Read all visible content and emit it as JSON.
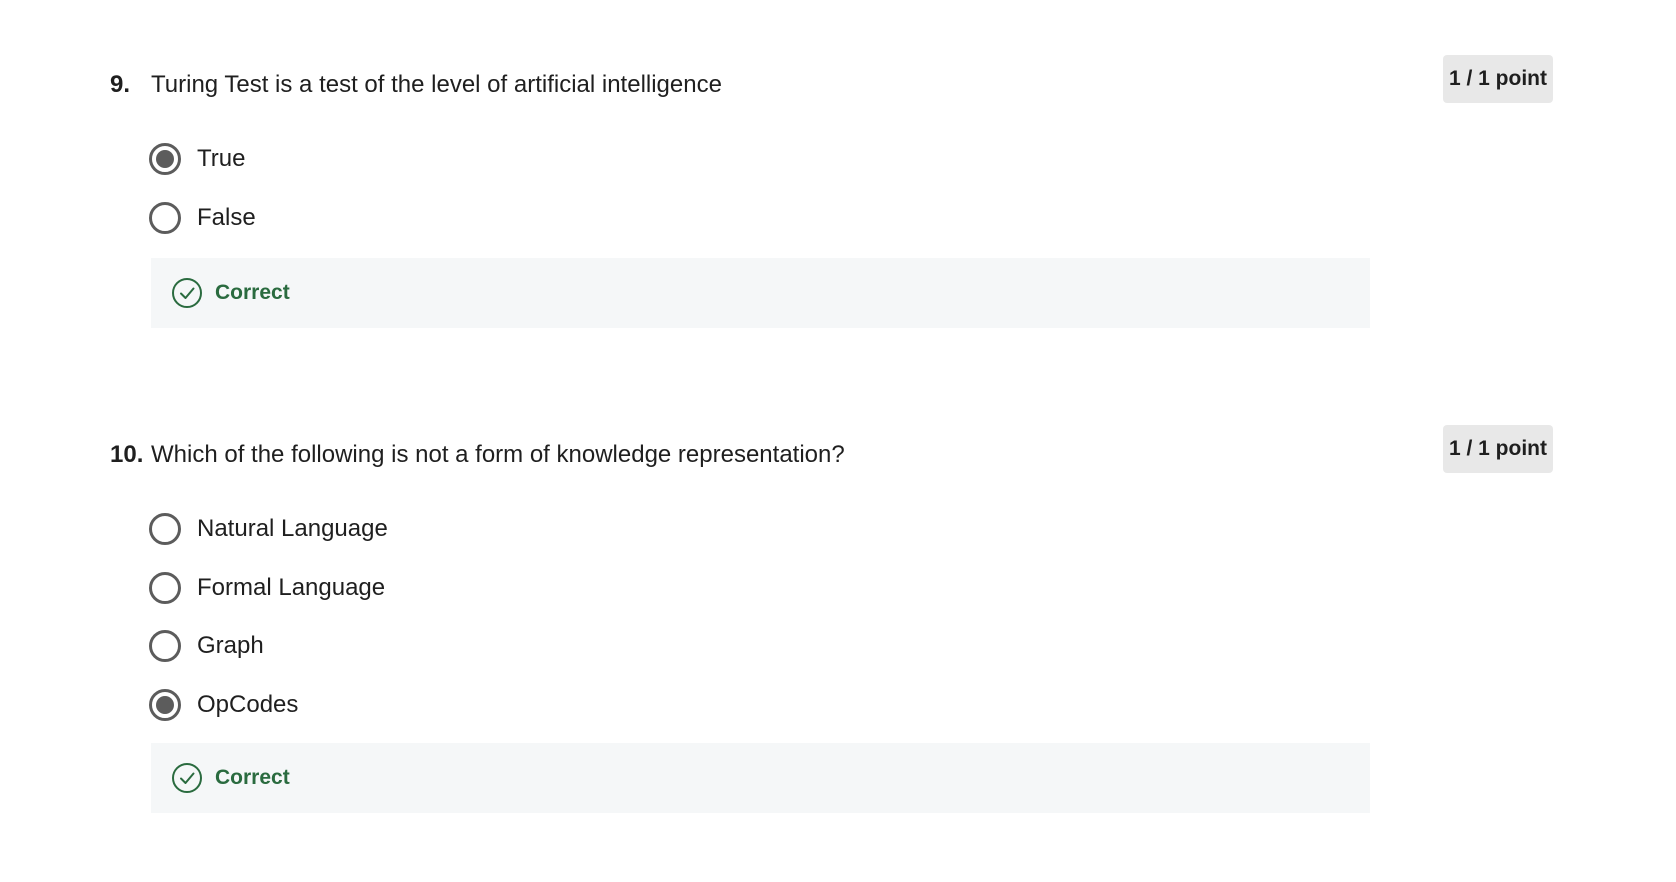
{
  "questions": [
    {
      "number": "9.",
      "text": "Turing Test is a test of the level of artificial intelligence",
      "points": "1 / 1 point",
      "options": [
        {
          "label": "True",
          "selected": true
        },
        {
          "label": "False",
          "selected": false
        }
      ],
      "feedback": "Correct"
    },
    {
      "number": "10.",
      "text": "Which of the following is not a form of knowledge representation?",
      "points": "1 / 1 point",
      "options": [
        {
          "label": "Natural Language",
          "selected": false
        },
        {
          "label": "Formal Language",
          "selected": false
        },
        {
          "label": "Graph",
          "selected": false
        },
        {
          "label": "OpCodes",
          "selected": true
        }
      ],
      "feedback": "Correct"
    }
  ],
  "colors": {
    "correct": "#2a6b3f",
    "radio": "#5c5c5c",
    "badge_bg": "#e8e8e8",
    "feedback_bg": "#f5f7f8"
  },
  "icons": {
    "selected_radio": "radio-selected-icon",
    "unselected_radio": "radio-unselected-icon",
    "feedback": "check-circle-icon"
  }
}
